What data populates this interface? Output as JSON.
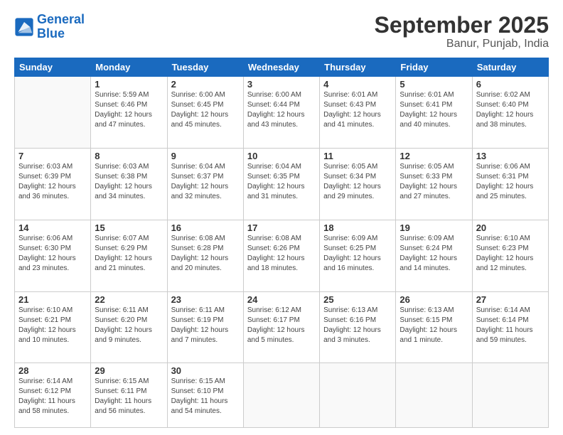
{
  "header": {
    "logo_line1": "General",
    "logo_line2": "Blue",
    "title": "September 2025",
    "subtitle": "Banur, Punjab, India"
  },
  "days_of_week": [
    "Sunday",
    "Monday",
    "Tuesday",
    "Wednesday",
    "Thursday",
    "Friday",
    "Saturday"
  ],
  "weeks": [
    [
      {
        "num": "",
        "info": ""
      },
      {
        "num": "1",
        "info": "Sunrise: 5:59 AM\nSunset: 6:46 PM\nDaylight: 12 hours\nand 47 minutes."
      },
      {
        "num": "2",
        "info": "Sunrise: 6:00 AM\nSunset: 6:45 PM\nDaylight: 12 hours\nand 45 minutes."
      },
      {
        "num": "3",
        "info": "Sunrise: 6:00 AM\nSunset: 6:44 PM\nDaylight: 12 hours\nand 43 minutes."
      },
      {
        "num": "4",
        "info": "Sunrise: 6:01 AM\nSunset: 6:43 PM\nDaylight: 12 hours\nand 41 minutes."
      },
      {
        "num": "5",
        "info": "Sunrise: 6:01 AM\nSunset: 6:41 PM\nDaylight: 12 hours\nand 40 minutes."
      },
      {
        "num": "6",
        "info": "Sunrise: 6:02 AM\nSunset: 6:40 PM\nDaylight: 12 hours\nand 38 minutes."
      }
    ],
    [
      {
        "num": "7",
        "info": "Sunrise: 6:03 AM\nSunset: 6:39 PM\nDaylight: 12 hours\nand 36 minutes."
      },
      {
        "num": "8",
        "info": "Sunrise: 6:03 AM\nSunset: 6:38 PM\nDaylight: 12 hours\nand 34 minutes."
      },
      {
        "num": "9",
        "info": "Sunrise: 6:04 AM\nSunset: 6:37 PM\nDaylight: 12 hours\nand 32 minutes."
      },
      {
        "num": "10",
        "info": "Sunrise: 6:04 AM\nSunset: 6:35 PM\nDaylight: 12 hours\nand 31 minutes."
      },
      {
        "num": "11",
        "info": "Sunrise: 6:05 AM\nSunset: 6:34 PM\nDaylight: 12 hours\nand 29 minutes."
      },
      {
        "num": "12",
        "info": "Sunrise: 6:05 AM\nSunset: 6:33 PM\nDaylight: 12 hours\nand 27 minutes."
      },
      {
        "num": "13",
        "info": "Sunrise: 6:06 AM\nSunset: 6:31 PM\nDaylight: 12 hours\nand 25 minutes."
      }
    ],
    [
      {
        "num": "14",
        "info": "Sunrise: 6:06 AM\nSunset: 6:30 PM\nDaylight: 12 hours\nand 23 minutes."
      },
      {
        "num": "15",
        "info": "Sunrise: 6:07 AM\nSunset: 6:29 PM\nDaylight: 12 hours\nand 21 minutes."
      },
      {
        "num": "16",
        "info": "Sunrise: 6:08 AM\nSunset: 6:28 PM\nDaylight: 12 hours\nand 20 minutes."
      },
      {
        "num": "17",
        "info": "Sunrise: 6:08 AM\nSunset: 6:26 PM\nDaylight: 12 hours\nand 18 minutes."
      },
      {
        "num": "18",
        "info": "Sunrise: 6:09 AM\nSunset: 6:25 PM\nDaylight: 12 hours\nand 16 minutes."
      },
      {
        "num": "19",
        "info": "Sunrise: 6:09 AM\nSunset: 6:24 PM\nDaylight: 12 hours\nand 14 minutes."
      },
      {
        "num": "20",
        "info": "Sunrise: 6:10 AM\nSunset: 6:23 PM\nDaylight: 12 hours\nand 12 minutes."
      }
    ],
    [
      {
        "num": "21",
        "info": "Sunrise: 6:10 AM\nSunset: 6:21 PM\nDaylight: 12 hours\nand 10 minutes."
      },
      {
        "num": "22",
        "info": "Sunrise: 6:11 AM\nSunset: 6:20 PM\nDaylight: 12 hours\nand 9 minutes."
      },
      {
        "num": "23",
        "info": "Sunrise: 6:11 AM\nSunset: 6:19 PM\nDaylight: 12 hours\nand 7 minutes."
      },
      {
        "num": "24",
        "info": "Sunrise: 6:12 AM\nSunset: 6:17 PM\nDaylight: 12 hours\nand 5 minutes."
      },
      {
        "num": "25",
        "info": "Sunrise: 6:13 AM\nSunset: 6:16 PM\nDaylight: 12 hours\nand 3 minutes."
      },
      {
        "num": "26",
        "info": "Sunrise: 6:13 AM\nSunset: 6:15 PM\nDaylight: 12 hours\nand 1 minute."
      },
      {
        "num": "27",
        "info": "Sunrise: 6:14 AM\nSunset: 6:14 PM\nDaylight: 11 hours\nand 59 minutes."
      }
    ],
    [
      {
        "num": "28",
        "info": "Sunrise: 6:14 AM\nSunset: 6:12 PM\nDaylight: 11 hours\nand 58 minutes."
      },
      {
        "num": "29",
        "info": "Sunrise: 6:15 AM\nSunset: 6:11 PM\nDaylight: 11 hours\nand 56 minutes."
      },
      {
        "num": "30",
        "info": "Sunrise: 6:15 AM\nSunset: 6:10 PM\nDaylight: 11 hours\nand 54 minutes."
      },
      {
        "num": "",
        "info": ""
      },
      {
        "num": "",
        "info": ""
      },
      {
        "num": "",
        "info": ""
      },
      {
        "num": "",
        "info": ""
      }
    ]
  ]
}
